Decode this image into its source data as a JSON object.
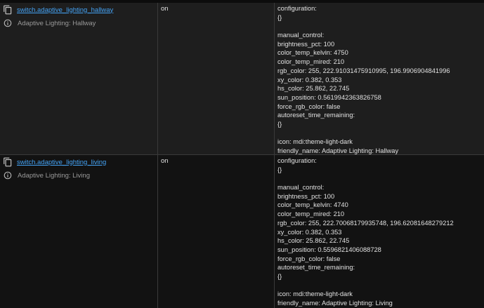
{
  "rows": [
    {
      "entity_id": "switch.adaptive_lighting_hallway",
      "friendly_name": "Adaptive Lighting: Hallway",
      "state": "on",
      "attributes": [
        "configuration:",
        "{}",
        "",
        "manual_control:",
        "brightness_pct: 100",
        "color_temp_kelvin: 4750",
        "color_temp_mired: 210",
        "rgb_color: 255, 222.91031475910995, 196.9906904841996",
        "xy_color: 0.382, 0.353",
        "hs_color: 25.862, 22.745",
        "sun_position: 0.5619942363826758",
        "force_rgb_color: false",
        "autoreset_time_remaining:",
        "{}",
        "",
        "icon: mdi:theme-light-dark",
        "friendly_name: Adaptive Lighting: Hallway"
      ]
    },
    {
      "entity_id": "switch.adaptive_lighting_living",
      "friendly_name": "Adaptive Lighting: Living",
      "state": "on",
      "attributes": [
        "configuration:",
        "{}",
        "",
        "manual_control:",
        "brightness_pct: 100",
        "color_temp_kelvin: 4740",
        "color_temp_mired: 210",
        "rgb_color: 255, 222.70068179935748, 196.62081648279212",
        "xy_color: 0.382, 0.353",
        "hs_color: 25.862, 22.745",
        "sun_position: 0.5596821406088728",
        "force_rgb_color: false",
        "autoreset_time_remaining:",
        "{}",
        "",
        "icon: mdi:theme-light-dark",
        "friendly_name: Adaptive Lighting: Living"
      ]
    }
  ],
  "icons": {
    "copy": "content-copy-icon",
    "info": "information-outline-icon"
  },
  "colors": {
    "link": "#44a3f5",
    "row_alt": "#1e1e1e",
    "background": "#121212",
    "text": "#e1e1e1",
    "muted": "#9a9a9a"
  }
}
